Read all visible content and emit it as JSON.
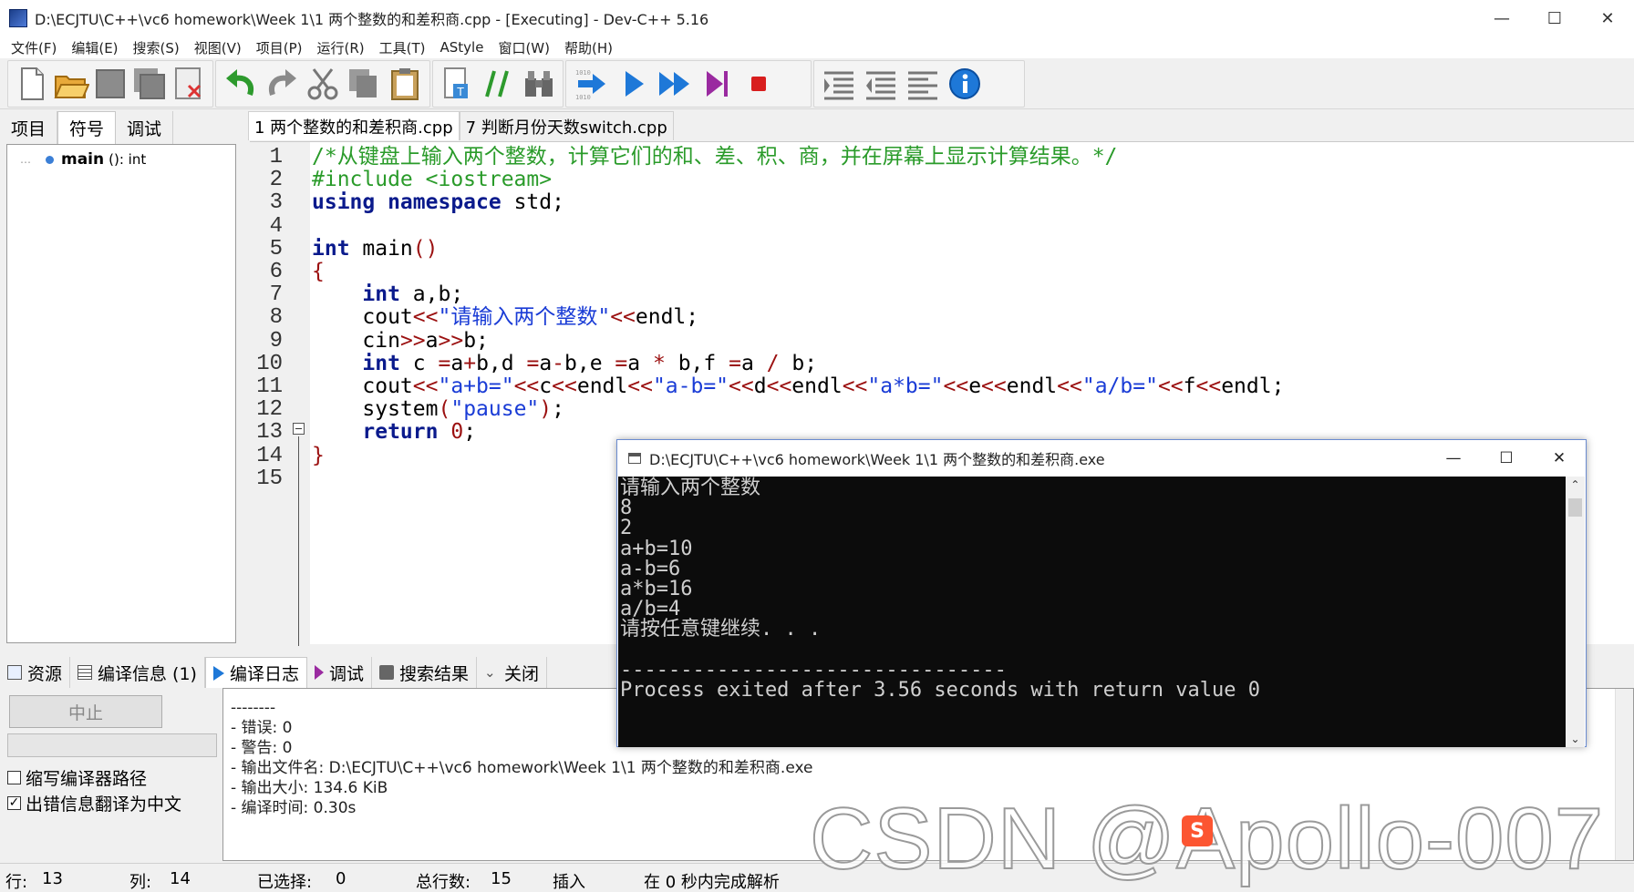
{
  "window": {
    "title": "D:\\ECJTU\\C++\\vc6 homework\\Week 1\\1 两个整数的和差积商.cpp - [Executing] - Dev-C++ 5.16",
    "minimize": "—",
    "maximize": "☐",
    "close": "✕"
  },
  "menu": [
    "文件(F)",
    "编辑(E)",
    "搜索(S)",
    "视图(V)",
    "项目(P)",
    "运行(R)",
    "工具(T)",
    "AStyle",
    "窗口(W)",
    "帮助(H)"
  ],
  "left_panel": {
    "tabs": [
      "项目",
      "符号",
      "调试"
    ],
    "active_tab": "符号",
    "tree": {
      "name": "main",
      "signature": "(): int"
    }
  },
  "editor": {
    "tabs": [
      "1 两个整数的和差积商.cpp",
      "7 判断月份天数switch.cpp"
    ],
    "active_tab": "1 两个整数的和差积商.cpp",
    "lines": [
      [
        [
          "comment",
          "/*从键盘上输入两个整数，计算它们的和、差、积、商，并在屏幕上显示计算结果。*/"
        ]
      ],
      [
        [
          "pre",
          "#include <iostream>"
        ]
      ],
      [
        [
          "kw",
          "using namespace"
        ],
        [
          "plain",
          " std;"
        ]
      ],
      [],
      [
        [
          "kw",
          "int"
        ],
        [
          "plain",
          " main"
        ],
        [
          "op",
          "()"
        ]
      ],
      [
        [
          "op",
          "{"
        ]
      ],
      [
        [
          "plain",
          "    "
        ],
        [
          "kw",
          "int"
        ],
        [
          "plain",
          " a,b;"
        ]
      ],
      [
        [
          "plain",
          "    cout"
        ],
        [
          "op",
          "<<"
        ],
        [
          "str",
          "\"请输入两个整数\""
        ],
        [
          "op",
          "<<"
        ],
        [
          "plain",
          "endl;"
        ]
      ],
      [
        [
          "plain",
          "    cin"
        ],
        [
          "op",
          ">>"
        ],
        [
          "plain",
          "a"
        ],
        [
          "op",
          ">>"
        ],
        [
          "plain",
          "b;"
        ]
      ],
      [
        [
          "plain",
          "    "
        ],
        [
          "kw",
          "int"
        ],
        [
          "plain",
          " c "
        ],
        [
          "op",
          "="
        ],
        [
          "plain",
          "a"
        ],
        [
          "op",
          "+"
        ],
        [
          "plain",
          "b,d "
        ],
        [
          "op",
          "="
        ],
        [
          "plain",
          "a"
        ],
        [
          "op",
          "-"
        ],
        [
          "plain",
          "b,e "
        ],
        [
          "op",
          "="
        ],
        [
          "plain",
          "a "
        ],
        [
          "op",
          "*"
        ],
        [
          "plain",
          " b,f "
        ],
        [
          "op",
          "="
        ],
        [
          "plain",
          "a "
        ],
        [
          "op",
          "/"
        ],
        [
          "plain",
          " b;"
        ]
      ],
      [
        [
          "plain",
          "    cout"
        ],
        [
          "op",
          "<<"
        ],
        [
          "str",
          "\"a+b=\""
        ],
        [
          "op",
          "<<"
        ],
        [
          "plain",
          "c"
        ],
        [
          "op",
          "<<"
        ],
        [
          "plain",
          "endl"
        ],
        [
          "op",
          "<<"
        ],
        [
          "str",
          "\"a-b=\""
        ],
        [
          "op",
          "<<"
        ],
        [
          "plain",
          "d"
        ],
        [
          "op",
          "<<"
        ],
        [
          "plain",
          "endl"
        ],
        [
          "op",
          "<<"
        ],
        [
          "str",
          "\"a*b=\""
        ],
        [
          "op",
          "<<"
        ],
        [
          "plain",
          "e"
        ],
        [
          "op",
          "<<"
        ],
        [
          "plain",
          "endl"
        ],
        [
          "op",
          "<<"
        ],
        [
          "str",
          "\"a/b=\""
        ],
        [
          "op",
          "<<"
        ],
        [
          "plain",
          "f"
        ],
        [
          "op",
          "<<"
        ],
        [
          "plain",
          "endl;"
        ]
      ],
      [
        [
          "plain",
          "    system"
        ],
        [
          "op",
          "("
        ],
        [
          "str",
          "\"pause\""
        ],
        [
          "op",
          ")"
        ],
        [
          "plain",
          ";"
        ]
      ],
      [
        [
          "plain",
          "    "
        ],
        [
          "kw",
          "return"
        ],
        [
          "plain",
          " "
        ],
        [
          "num",
          "0"
        ],
        [
          "plain",
          ";"
        ]
      ],
      [
        [
          "op",
          "}"
        ]
      ],
      []
    ]
  },
  "bottom": {
    "tabs": [
      "资源",
      "编译信息 (1)",
      "编译日志",
      "调试",
      "搜索结果",
      "关闭"
    ],
    "active_tab": "编译日志",
    "stop_label": "中止",
    "checkbox1": {
      "checked_mark": "",
      "label": "缩写编译器路径"
    },
    "checkbox2": {
      "checked_mark": "✓",
      "label": "出错信息翻译为中文"
    },
    "log": [
      "--------",
      "- 错误: 0",
      "- 警告: 0",
      "- 输出文件名: D:\\ECJTU\\C++\\vc6 homework\\Week 1\\1 两个整数的和差积商.exe",
      "- 输出大小: 134.6 KiB",
      "- 编译时间: 0.30s"
    ]
  },
  "status": {
    "row_label": "行:",
    "row_value": "13",
    "col_label": "列:",
    "col_value": "14",
    "sel_label": "已选择:",
    "sel_value": "0",
    "total_label": "总行数:",
    "total_value": "15",
    "mode": "插入",
    "parse": "在 0 秒内完成解析"
  },
  "console": {
    "title": "D:\\ECJTU\\C++\\vc6 homework\\Week 1\\1 两个整数的和差积商.exe",
    "lines": [
      "请输入两个整数",
      "8",
      "2",
      "a+b=10",
      "a-b=6",
      "a*b=16",
      "a/b=4",
      "请按任意键继续. . .",
      "",
      "--------------------------------",
      "Process exited after 3.56 seconds with return value 0"
    ]
  },
  "watermark": "CSDN @Apollo-007"
}
